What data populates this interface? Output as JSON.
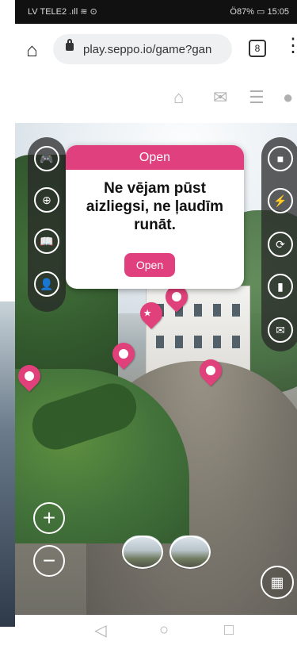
{
  "statusbar": {
    "left": "LV TELE2 .ıll ≋ ⊙",
    "right": "Ö87% ▭ 15:05"
  },
  "browser": {
    "url": "play.seppo.io/game?gan",
    "tabs_count": "8"
  },
  "game_toolbar": {
    "icons": [
      "home-icon",
      "chat-icon",
      "clipboard-icon",
      "user-icon"
    ]
  },
  "popup": {
    "header": "Open",
    "title": "Ne vējam pūst aizliegsi, ne ļaudīm runāt.",
    "button": "Open"
  },
  "left_panel_icons": [
    "gamepad-icon",
    "location-plus-icon",
    "book-icon",
    "profile-icon"
  ],
  "right_panel_icons": [
    "stop-icon",
    "lightning-icon",
    "refresh-pin-icon",
    "chart-icon",
    "message-icon"
  ],
  "zoom": {
    "plus": "+",
    "minus": "−"
  },
  "colors": {
    "accent": "#e1407f",
    "panel": "#2f2f2f"
  }
}
